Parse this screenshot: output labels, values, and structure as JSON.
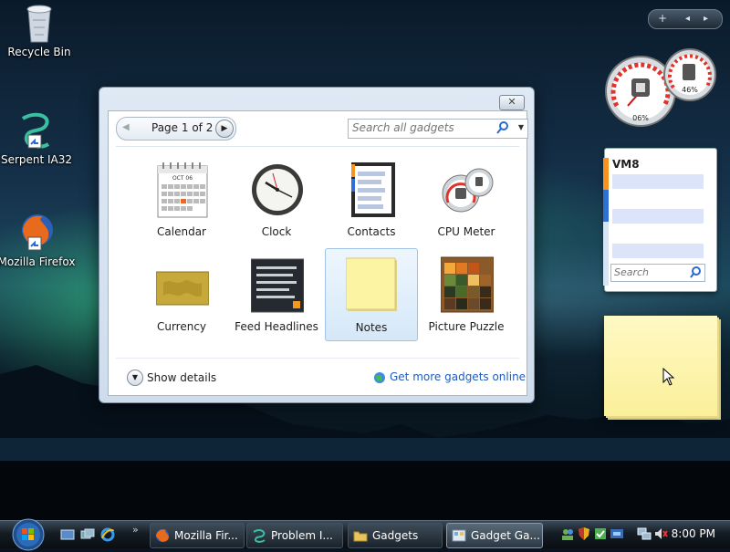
{
  "desktop": {
    "icons": [
      {
        "label": "Recycle Bin",
        "icon": "recycle-bin-icon"
      },
      {
        "label": "Serpent IA32",
        "icon": "serpent-icon"
      },
      {
        "label": "Mozilla Firefox",
        "icon": "firefox-icon"
      }
    ]
  },
  "gallery": {
    "close_label": "✕",
    "pager": {
      "text": "Page 1 of 2"
    },
    "search": {
      "placeholder": "Search all gadgets"
    },
    "gadgets": [
      {
        "name": "Calendar",
        "icon": "calendar-icon",
        "selected": false,
        "month": "OCT 06"
      },
      {
        "name": "Clock",
        "icon": "clock-icon",
        "selected": false
      },
      {
        "name": "Contacts",
        "icon": "contacts-icon",
        "selected": false
      },
      {
        "name": "CPU Meter",
        "icon": "cpu-meter-icon",
        "selected": false
      },
      {
        "name": "Currency",
        "icon": "currency-icon",
        "selected": false
      },
      {
        "name": "Feed Headlines",
        "icon": "feed-headlines-icon",
        "selected": false
      },
      {
        "name": "Notes",
        "icon": "notes-icon",
        "selected": true
      },
      {
        "name": "Picture Puzzle",
        "icon": "picture-puzzle-icon",
        "selected": false
      }
    ],
    "show_details": "Show details",
    "get_more": "Get more gadgets online"
  },
  "sidebar": {
    "controls": {
      "add": "+",
      "prev": "◂",
      "next": "▸"
    },
    "cpu_meter": {
      "cpu_percent": "06%",
      "ram_percent": "46%"
    },
    "contacts_gadget": {
      "title": "VM8",
      "search_placeholder": "Search"
    }
  },
  "taskbar": {
    "buttons": [
      {
        "label": "Mozilla Fir...",
        "icon": "firefox-icon",
        "active": false
      },
      {
        "label": "Problem I...",
        "icon": "serpent-icon",
        "active": false
      },
      {
        "label": "Gadgets",
        "icon": "folder-icon",
        "active": false
      },
      {
        "label": "Gadget Ga...",
        "icon": "gadget-gallery-icon",
        "active": true
      }
    ],
    "more": "»",
    "clock": "8:00 PM"
  },
  "colors": {
    "link": "#1e5dbb",
    "selection": "#d5e8f8",
    "note_yellow": "#fbef9a"
  }
}
